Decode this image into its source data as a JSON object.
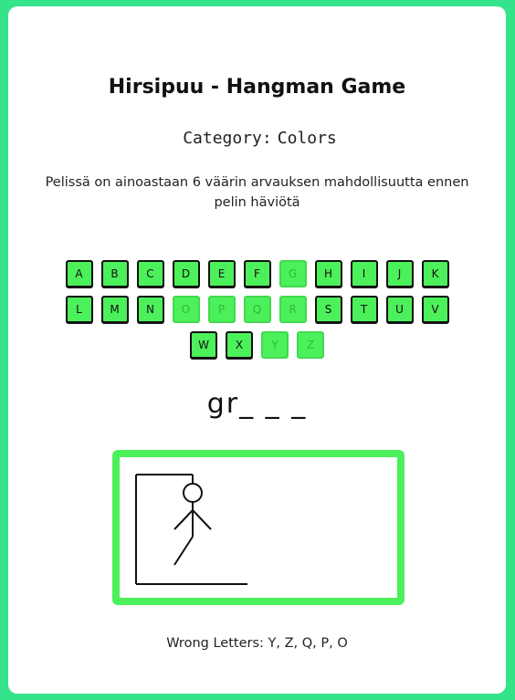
{
  "title": "Hirsipuu - Hangman Game",
  "category": {
    "label": "Category:",
    "value": "Colors"
  },
  "info": "Pelissä on ainoastaan 6 väärin arvauksen mahdollisuutta ennen pelin häviötä",
  "keyboard": {
    "rows": [
      [
        {
          "letter": "A",
          "used": false
        },
        {
          "letter": "B",
          "used": false
        },
        {
          "letter": "C",
          "used": false
        },
        {
          "letter": "D",
          "used": false
        },
        {
          "letter": "E",
          "used": false
        },
        {
          "letter": "F",
          "used": false
        },
        {
          "letter": "G",
          "used": true
        },
        {
          "letter": "H",
          "used": false
        },
        {
          "letter": "I",
          "used": false
        },
        {
          "letter": "J",
          "used": false
        },
        {
          "letter": "K",
          "used": false
        }
      ],
      [
        {
          "letter": "L",
          "used": false
        },
        {
          "letter": "M",
          "used": false
        },
        {
          "letter": "N",
          "used": false
        },
        {
          "letter": "O",
          "used": true
        },
        {
          "letter": "P",
          "used": true
        },
        {
          "letter": "Q",
          "used": true
        },
        {
          "letter": "R",
          "used": true
        },
        {
          "letter": "S",
          "used": false
        },
        {
          "letter": "T",
          "used": false
        },
        {
          "letter": "U",
          "used": false
        },
        {
          "letter": "V",
          "used": false
        }
      ],
      [
        {
          "letter": "W",
          "used": false
        },
        {
          "letter": "X",
          "used": false
        },
        {
          "letter": "Y",
          "used": true
        },
        {
          "letter": "Z",
          "used": true
        }
      ]
    ]
  },
  "word_display": "gr_ _ _",
  "wrong_letters": "Wrong Letters: Y, Z, Q, P, O",
  "colors": {
    "background": "#35e38a",
    "key": "#4cf05a",
    "frame": "#4cf05a"
  }
}
